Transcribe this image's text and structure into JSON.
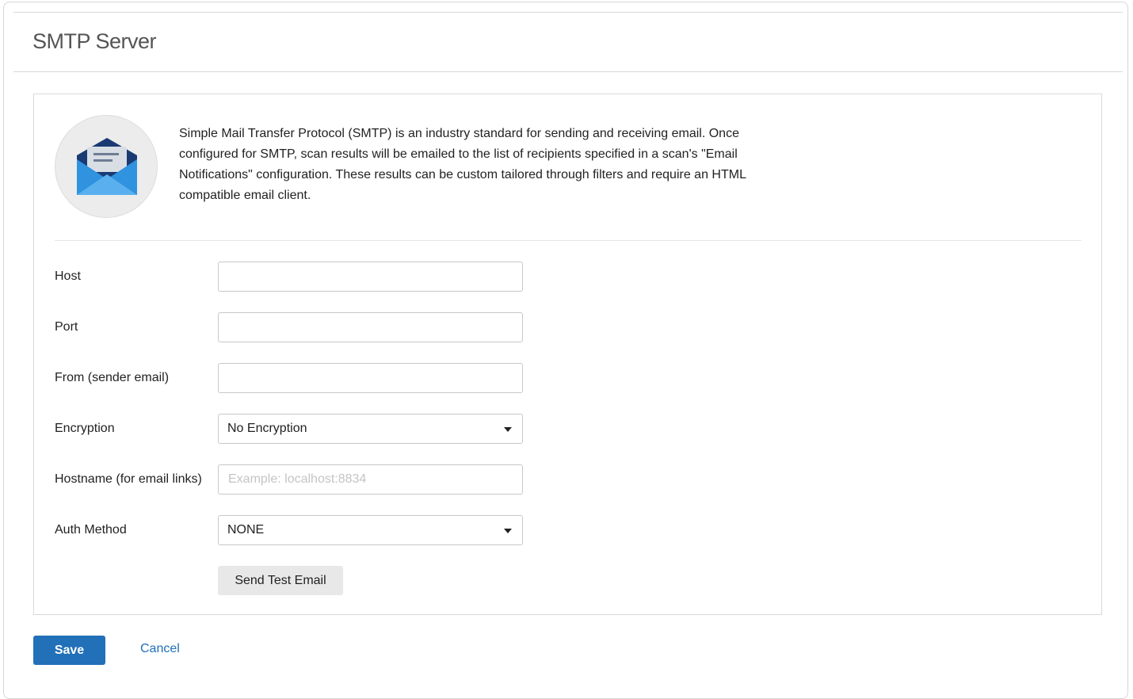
{
  "header": {
    "title": "SMTP Server"
  },
  "intro": {
    "icon": "envelope-icon",
    "description": "Simple Mail Transfer Protocol (SMTP) is an industry standard for sending and receiving email. Once configured for SMTP, scan results will be emailed to the list of recipients specified in a scan's \"Email Notifications\" configuration. These results can be custom tailored through filters and require an HTML compatible email client."
  },
  "form": {
    "host": {
      "label": "Host",
      "value": "",
      "placeholder": ""
    },
    "port": {
      "label": "Port",
      "value": "",
      "placeholder": ""
    },
    "from": {
      "label": "From (sender email)",
      "value": "",
      "placeholder": ""
    },
    "encryption": {
      "label": "Encryption",
      "selected": "No Encryption"
    },
    "hostname": {
      "label": "Hostname (for email links)",
      "value": "",
      "placeholder": "Example: localhost:8834"
    },
    "auth_method": {
      "label": "Auth Method",
      "selected": "NONE"
    },
    "send_test_label": "Send Test Email"
  },
  "actions": {
    "save_label": "Save",
    "cancel_label": "Cancel"
  },
  "colors": {
    "primary": "#2170b8",
    "envelope_dark": "#1a3a73",
    "envelope_light": "#2f93df"
  }
}
